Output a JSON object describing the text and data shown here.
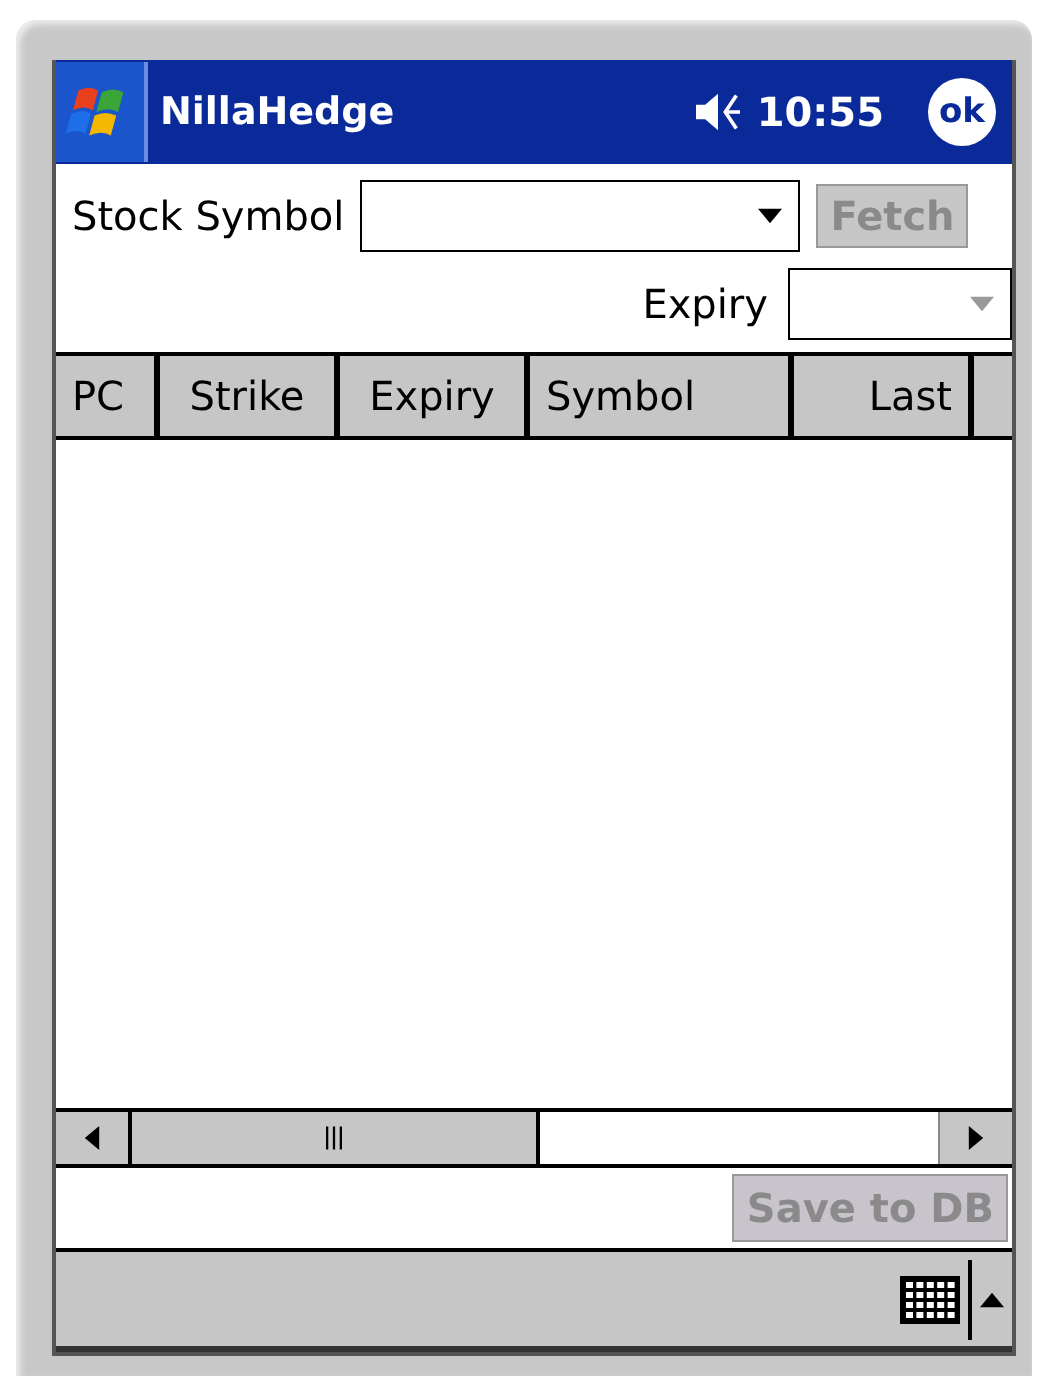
{
  "title_bar": {
    "title": "NillaHedge",
    "time": "10:55",
    "ok_label": "ok"
  },
  "symbol_row": {
    "label": "Stock Symbol",
    "fetch_button": {
      "label": "Fetch",
      "disabled": true
    }
  },
  "expiry_row": {
    "label": "Expiry"
  },
  "table": {
    "columns": [
      {
        "label": "PC"
      },
      {
        "label": "Strike"
      },
      {
        "label": "Expiry"
      },
      {
        "label": "Symbol"
      },
      {
        "label": "Last"
      }
    ]
  },
  "save_button": {
    "label": "Save to DB",
    "disabled": true
  }
}
